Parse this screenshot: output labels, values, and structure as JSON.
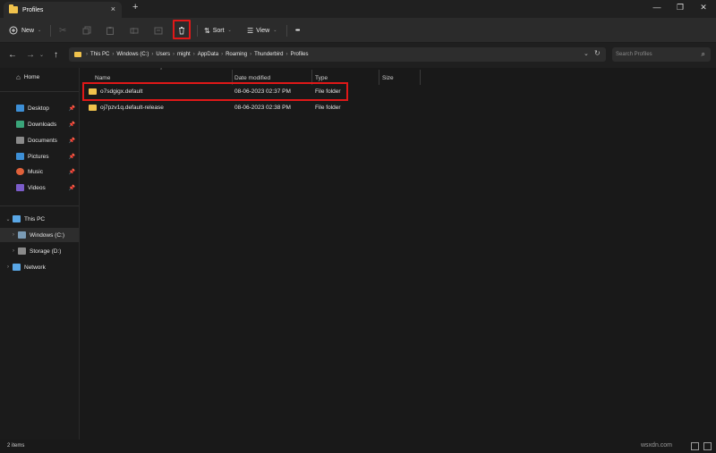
{
  "window": {
    "tab_title": "Profiles",
    "tab_close": "×",
    "tab_add": "+",
    "controls": [
      "—",
      "❐",
      "✕"
    ]
  },
  "toolbar": {
    "new_label": "New",
    "sort_label": "Sort",
    "view_label": "View",
    "more_label": "•••"
  },
  "address": {
    "crumbs": [
      "This PC",
      "Windows (C:)",
      "Users",
      "might",
      "AppData",
      "Roaming",
      "Thunderbird",
      "Profiles"
    ],
    "search_placeholder": "Search Profiles"
  },
  "nav": {
    "home": "Home",
    "quick": [
      {
        "label": "Desktop",
        "color": "#3d8fd6"
      },
      {
        "label": "Downloads",
        "color": "#3aa57a"
      },
      {
        "label": "Documents",
        "color": "#8a8a8a"
      },
      {
        "label": "Pictures",
        "color": "#3d8fd6"
      },
      {
        "label": "Music",
        "color": "#e0613a"
      },
      {
        "label": "Videos",
        "color": "#7b5cc9"
      }
    ],
    "this_pc": "This PC",
    "drives": [
      "Windows (C:)",
      "Storage (D:)"
    ],
    "network": "Network"
  },
  "columns": {
    "name": "Name",
    "date_modified": "Date modified",
    "type": "Type",
    "size": "Size"
  },
  "files": [
    {
      "name": "o7sdgigx.default",
      "date": "08-06-2023 02:37 PM",
      "type": "File folder"
    },
    {
      "name": "oj7pzv1q.default-release",
      "date": "08-06-2023 02:38 PM",
      "type": "File folder"
    }
  ],
  "status": {
    "count": "2 items",
    "watermark": "wsxdn.com"
  },
  "colors": {
    "highlight": "#e01818",
    "folder": "#f0c24c"
  }
}
